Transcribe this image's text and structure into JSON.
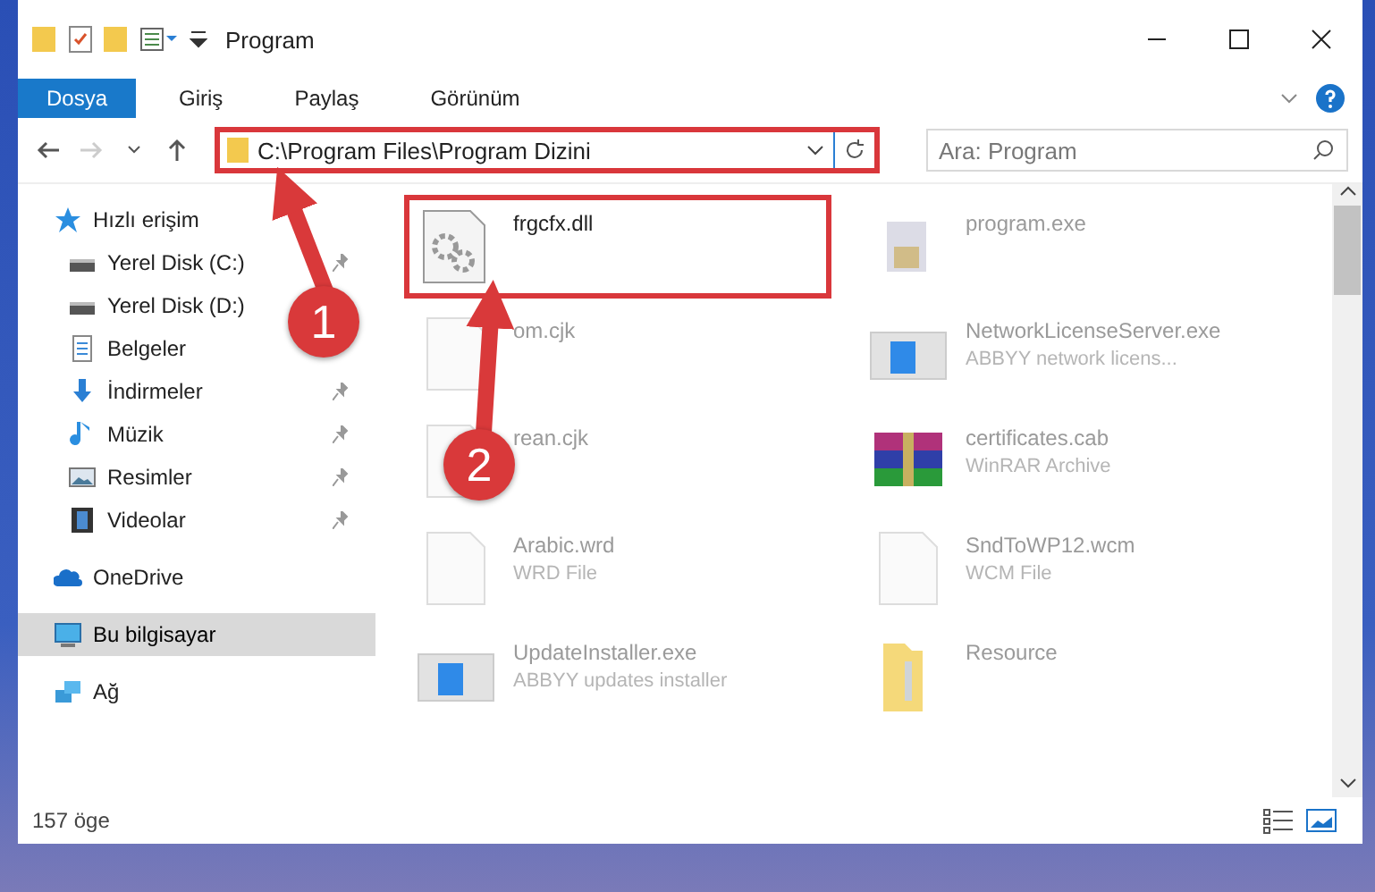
{
  "window": {
    "title": "Program"
  },
  "ribbon_tabs": [
    {
      "label": "Dosya",
      "selected": true
    },
    {
      "label": "Giriş",
      "selected": false
    },
    {
      "label": "Paylaş",
      "selected": false
    },
    {
      "label": "Görünüm",
      "selected": false
    }
  ],
  "address": {
    "path": "C:\\Program Files\\Program Dizini",
    "highlighted": true
  },
  "search": {
    "placeholder": "Ara: Program"
  },
  "sidebar": {
    "items": [
      {
        "label": "Hızlı erişim",
        "kind": "star",
        "selected": false,
        "children": [
          {
            "label": "Yerel Disk (C:)",
            "kind": "drive",
            "pinned": true
          },
          {
            "label": "Yerel Disk (D:)",
            "kind": "drive"
          },
          {
            "label": "Belgeler",
            "kind": "documents"
          },
          {
            "label": "İndirmeler",
            "kind": "download",
            "pinned": true
          },
          {
            "label": "Müzik",
            "kind": "music",
            "pinned": true
          },
          {
            "label": "Resimler",
            "kind": "pictures",
            "pinned": true
          },
          {
            "label": "Videolar",
            "kind": "videos",
            "pinned": true
          }
        ]
      },
      {
        "label": "OneDrive",
        "kind": "cloud",
        "selected": false
      },
      {
        "label": "Bu bilgisayar",
        "kind": "computer",
        "selected": true
      },
      {
        "label": "Ağ",
        "kind": "network",
        "selected": false
      }
    ]
  },
  "files": [
    {
      "name": "frgcfx.dll",
      "kind": "dll",
      "highlighted": true
    },
    {
      "name": "program.exe",
      "kind": "app",
      "highlighted": false
    },
    {
      "name": "om.cjk",
      "kind": "blank",
      "highlighted": false
    },
    {
      "name": "NetworkLicenseServer.exe",
      "type": "ABBYY network licens...",
      "kind": "installer",
      "highlighted": false
    },
    {
      "name": "rean.cjk",
      "kind": "blank",
      "highlighted": false
    },
    {
      "name": "certificates.cab",
      "type": "WinRAR Archive",
      "kind": "archive",
      "highlighted": false
    },
    {
      "name": "Arabic.wrd",
      "type": "WRD File",
      "kind": "blank",
      "highlighted": false
    },
    {
      "name": "SndToWP12.wcm",
      "type": "WCM File",
      "kind": "blank",
      "highlighted": false
    },
    {
      "name": "UpdateInstaller.exe",
      "type": "ABBYY updates installer",
      "kind": "installer",
      "highlighted": false
    },
    {
      "name": "Resource",
      "kind": "folder",
      "highlighted": false
    }
  ],
  "status_bar": {
    "count": "157 öge"
  },
  "annotations": [
    {
      "number": "1"
    },
    {
      "number": "2"
    }
  ]
}
